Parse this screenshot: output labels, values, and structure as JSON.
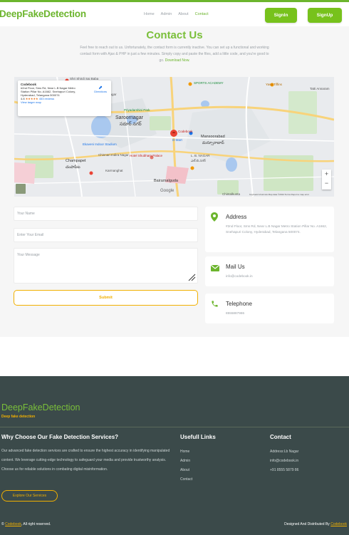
{
  "nav": {
    "brand": "DeepFakeDetection",
    "links": [
      "Home",
      "Admin",
      "About",
      "Contact"
    ],
    "signin": "SignIn",
    "signup": "SignUp"
  },
  "contact": {
    "title": "Contact Us",
    "description": "Feel free to reach out to us. Unfortunately, the contact form is currently inactive. You can set up a functional and working contact form with Ajax & PHP in just a few minutes. Simply copy and paste the files, add a little code, and you're good to go.",
    "download_link": "Download Now."
  },
  "map": {
    "place_name": "Codebook",
    "place_address": "#2nd Floor, Sms Rd, Near L.B Nagar Metro Station Pillar No. A1662, Snehapuri Colony, Hyderabad, Telangana 500074",
    "rating": "4.8",
    "stars": "★★★★★",
    "reviews": "453 reviews",
    "larger_map": "View larger map",
    "directions": "Directions",
    "marker_label": "Codebook",
    "labels": [
      "Shri Shirdi Sai Baba",
      "Laxmi Nagar",
      "SPORTS ACADEMY",
      "Yasa Tiffins",
      "Tatti Annaram",
      "Saroornagar",
      "సరూర్ నగర్",
      "Mansoorabad",
      "మన్సూరాబాద్",
      "Champapet",
      "చంపాపేట",
      "L. B. NAGAR",
      "ఎల్.బి.నగర్",
      "Karmanghat",
      "Bairamalguda",
      "Chintalkunta",
      "Priyadarshini Park",
      "Ekaveni Indoor Stadium",
      "Hotel Shubham Palace",
      "D-Mart",
      "Chinnari Indira Nagar"
    ],
    "google": "Google",
    "attribution": "Keyboard shortcuts   Map data ©2024   Terms   Report a map error"
  },
  "form": {
    "name_placeholder": "Your Name",
    "email_placeholder": "Enter Your Email",
    "message_placeholder": "Your Message",
    "submit": "Submit"
  },
  "info": {
    "address_label": "Address",
    "address_value": "#2nd Floor, Sms Rd, Near L.B Nagar Metro Station Pillar No. A1662, Snehapuri Colony, Hyderabad, Telangana 500074.",
    "mail_label": "Mail Us",
    "mail_value": "info@codebook.in",
    "phone_label": "Telephone",
    "phone_value": "8555887986"
  },
  "footer": {
    "brand": "DeepFakeDetection",
    "tagline": "Deep fake detection",
    "why_title": "Why Choose Our Fake Detection Services?",
    "why_text": "Our advanced fake detection services are crafted to ensure the highest accuracy in identifying manipulated content. We leverage cutting-edge technology to safeguard your media and provide trustworthy analysis. Choose us for reliable solutions in combating digital misinformation.",
    "explore": "Explore Our Services",
    "links_title": "Usefull Links",
    "links": [
      "Home",
      "Admin",
      "About",
      "Contact"
    ],
    "contact_title": "Contact",
    "contact_items": [
      "Address:Lb Nagar",
      "info@codebook.in",
      "+91 8555 5879 86"
    ],
    "copyright_brand": "Codebook",
    "copyright_rest": ", All right reserved.",
    "designed_by": "Designed And Distributed By",
    "designed_brand": "Codebook"
  },
  "colors": {
    "brand_green": "#6cb52d",
    "accent_yellow": "#f1b000",
    "footer_bg": "#3b4a4a"
  }
}
